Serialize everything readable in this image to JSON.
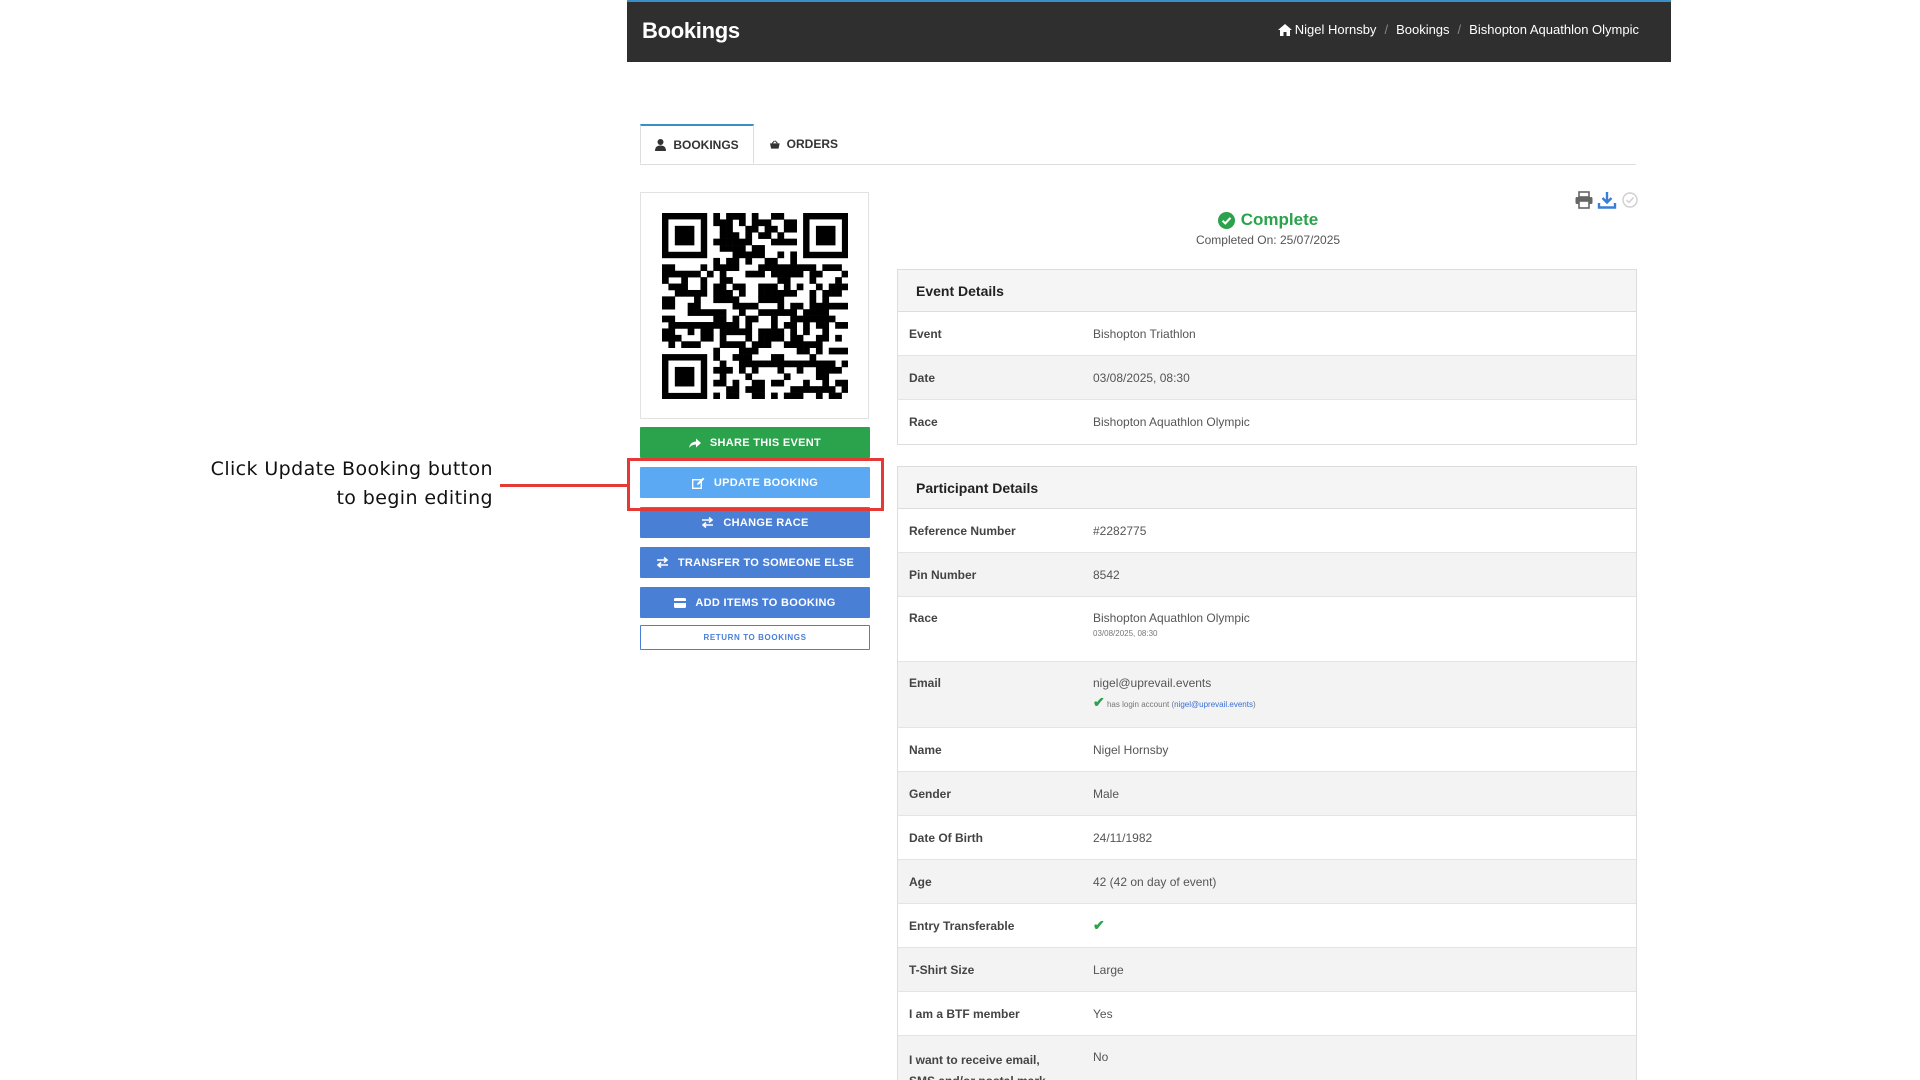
{
  "header": {
    "title": "Bookings",
    "breadcrumb": [
      "Nigel Hornsby",
      "Bookings",
      "Bishopton Aquathlon Olympic"
    ]
  },
  "tabs": [
    {
      "label": "Bookings",
      "icon": "user-icon",
      "active": true
    },
    {
      "label": "Orders",
      "icon": "basket-icon",
      "active": false
    }
  ],
  "actions": {
    "share": "Share this event",
    "update": "Update booking",
    "change_race": "Change race",
    "transfer": "Transfer to someone else",
    "add_items": "Add items to booking",
    "return": "Return to bookings"
  },
  "annotation": {
    "line1": "Click Update Booking button",
    "line2": "to begin editing",
    "color": "#e53935"
  },
  "status": {
    "label": "Complete",
    "completed_on": "Completed On: 25/07/2025",
    "color": "#2ba24c"
  },
  "event_details": {
    "heading": "Event Details",
    "rows": [
      {
        "label": "Event",
        "value": "Bishopton Triathlon"
      },
      {
        "label": "Date",
        "value": "03/08/2025, 08:30"
      },
      {
        "label": "Race",
        "value": "Bishopton Aquathlon Olympic"
      }
    ]
  },
  "participant_details": {
    "heading": "Participant Details",
    "reference_label": "Reference Number",
    "reference_value": "#2282775",
    "pin_label": "Pin Number",
    "pin_value": "8542",
    "race_label": "Race",
    "race_value": "Bishopton Aquathlon Olympic",
    "race_sub": "03/08/2025, 08:30",
    "email_label": "Email",
    "email_value": "nigel@uprevail.events",
    "email_sub_prefix": "has login account (",
    "email_sub_link": "nigel@uprevail.events",
    "email_sub_suffix": ")",
    "name_label": "Name",
    "name_value": "Nigel Hornsby",
    "gender_label": "Gender",
    "gender_value": "Male",
    "dob_label": "Date Of Birth",
    "dob_value": "24/11/1982",
    "age_label": "Age",
    "age_value": "42 (42 on day of event)",
    "transferable_label": "Entry Transferable",
    "transferable_value": "✔",
    "tshirt_label": "T-Shirt Size",
    "tshirt_value": "Large",
    "btf_label": "I am a BTF member",
    "btf_value": "Yes",
    "marketing_label": "I want to receive email, SMS and/or postal mark...",
    "marketing_value": "No"
  }
}
